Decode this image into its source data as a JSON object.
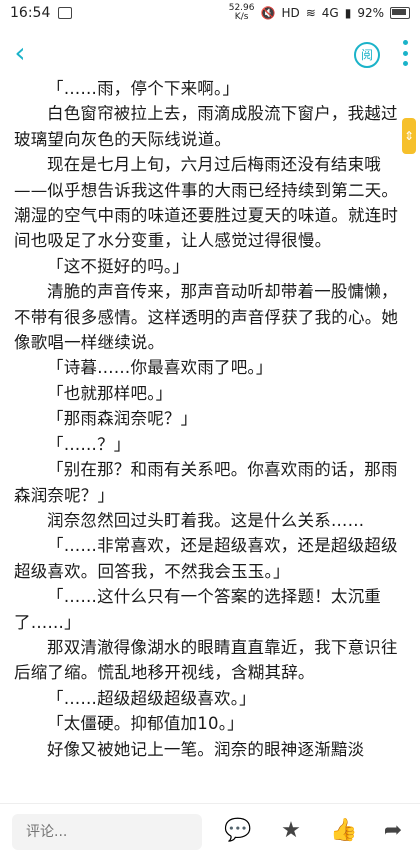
{
  "status": {
    "time": "16:54",
    "speed_value": "52.96",
    "speed_unit": "K/s",
    "hd": "HD",
    "net": "4G",
    "battery": "92%"
  },
  "topbar": {
    "read_label": "阅"
  },
  "paragraphs": [
    "「……雨，停个下来啊。」",
    "白色窗帘被拉上去，雨滴成股流下窗户，我越过玻璃望向灰色的天际线说道。",
    "现在是七月上旬，六月过后梅雨还没有结束哦——似乎想告诉我这件事的大雨已经持续到第二天。潮湿的空气中雨的味道还要胜过夏天的味道。就连时间也吸足了水分变重，让人感觉过得很慢。",
    "「这不挺好的吗。」",
    "清脆的声音传来，那声音动听却带着一股慵懒，不带有很多感情。这样透明的声音俘获了我的心。她像歌唱一样继续说。",
    "「诗暮……你最喜欢雨了吧。」",
    "「也就那样吧。」",
    "「那雨森润奈呢？」",
    "「……？」",
    "「别在那？和雨有关系吧。你喜欢雨的话，那雨森润奈呢？」",
    "润奈忽然回过头盯着我。这是什么关系……",
    "「……非常喜欢，还是超级喜欢，还是超级超级超级喜欢。回答我，不然我会玉玉。」",
    "「……这什么只有一个答案的选择题！太沉重了……」",
    "那双清澈得像湖水的眼睛直直靠近，我下意识往后缩了缩。慌乱地移开视线，含糊其辞。",
    "「……超级超级超级喜欢。」",
    "「太僵硬。抑郁值加10。」",
    "好像又被她记上一笔。润奈的眼神逐渐黯淡"
  ],
  "bottom": {
    "comment_placeholder": "评论..."
  }
}
